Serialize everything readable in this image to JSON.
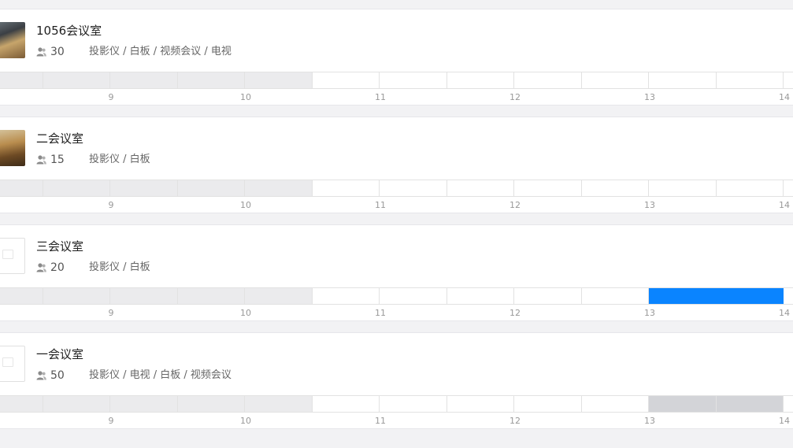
{
  "colors": {
    "page_bg": "#f2f2f4",
    "past_slot": "#ebebed",
    "booked_slot": "#0a84ff",
    "reserved_slot": "#d3d4d8"
  },
  "icons": {
    "capacity": "user-group-icon",
    "thumbnail_placeholder": "image-placeholder-icon"
  },
  "rooms": [
    {
      "name": "1056会议室",
      "capacity": "30",
      "equipment": "投影仪 / 白板 / 视频会议 / 电视",
      "thumbnail": "photo",
      "hour_labels": [
        "9",
        "10",
        "11",
        "12",
        "13",
        "14"
      ],
      "slots": [
        "past",
        "past",
        "past",
        "past",
        "past",
        "free",
        "free",
        "free",
        "free",
        "free",
        "free",
        "free"
      ]
    },
    {
      "name": "二会议室",
      "capacity": "15",
      "equipment": "投影仪 / 白板",
      "thumbnail": "photo",
      "hour_labels": [
        "9",
        "10",
        "11",
        "12",
        "13",
        "14"
      ],
      "slots": [
        "past",
        "past",
        "past",
        "past",
        "past",
        "free",
        "free",
        "free",
        "free",
        "free",
        "free",
        "free"
      ]
    },
    {
      "name": "三会议室",
      "capacity": "20",
      "equipment": "投影仪 / 白板",
      "thumbnail": "placeholder",
      "hour_labels": [
        "9",
        "10",
        "11",
        "12",
        "13",
        "14"
      ],
      "slots": [
        "past",
        "past",
        "past",
        "past",
        "past",
        "free",
        "free",
        "free",
        "free",
        "free",
        "booked",
        "booked"
      ]
    },
    {
      "name": "一会议室",
      "capacity": "50",
      "equipment": "投影仪 / 电视 / 白板 / 视频会议",
      "thumbnail": "placeholder",
      "hour_labels": [
        "9",
        "10",
        "11",
        "12",
        "13",
        "14"
      ],
      "slots": [
        "past",
        "past",
        "past",
        "past",
        "past",
        "free",
        "free",
        "free",
        "free",
        "free",
        "reserved",
        "reserved"
      ]
    }
  ]
}
